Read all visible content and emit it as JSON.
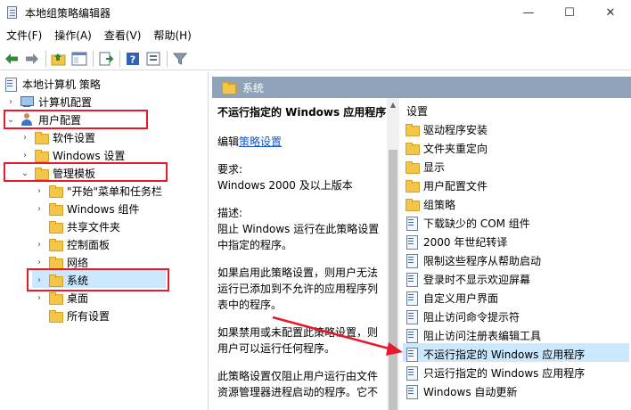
{
  "window": {
    "title": "本地组策略编辑器",
    "minimize": "—",
    "maximize": "☐",
    "close": "✕"
  },
  "menu": [
    "文件(F)",
    "操作(A)",
    "查看(V)",
    "帮助(H)"
  ],
  "tree": {
    "root": "本地计算机 策略",
    "computer_config": "计算机配置",
    "user_config": "用户配置",
    "software_settings": "软件设置",
    "windows_settings": "Windows 设置",
    "admin_templates": "管理模板",
    "start_menu": "\"开始\"菜单和任务栏",
    "windows_components": "Windows 组件",
    "shared_folders": "共享文件夹",
    "control_panel": "控制面板",
    "network": "网络",
    "system": "系统",
    "desktop": "桌面",
    "all_settings": "所有设置"
  },
  "header": {
    "title": "系统"
  },
  "description": {
    "title": "不运行指定的 Windows 应用程序",
    "edit_prefix": "编辑",
    "edit_link": "策略设置",
    "requirements_label": "要求:",
    "requirements_value": "Windows 2000 及以上版本",
    "desc_label": "描述:",
    "desc_text": "阻止 Windows 运行在此策略设置中指定的程序。",
    "enabled_text": "如果启用此策略设置，则用户无法运行已添加到不允许的应用程序列表中的程序。",
    "disabled_text": "如果禁用或未配置此策略设置，则用户可以运行任何程序。",
    "note_text": "此策略设置仅阻止用户运行由文件资源管理器进程启动的程序。它不"
  },
  "list": {
    "header": "设置",
    "items": [
      {
        "label": "驱动程序安装",
        "kind": "folder"
      },
      {
        "label": "文件夹重定向",
        "kind": "folder"
      },
      {
        "label": "显示",
        "kind": "folder"
      },
      {
        "label": "用户配置文件",
        "kind": "folder"
      },
      {
        "label": "组策略",
        "kind": "folder"
      },
      {
        "label": "下载缺少的 COM 组件",
        "kind": "policy"
      },
      {
        "label": "2000 年世纪转译",
        "kind": "policy"
      },
      {
        "label": "限制这些程序从帮助启动",
        "kind": "policy"
      },
      {
        "label": "登录时不显示欢迎屏幕",
        "kind": "policy"
      },
      {
        "label": "自定义用户界面",
        "kind": "policy"
      },
      {
        "label": "阻止访问命令提示符",
        "kind": "policy"
      },
      {
        "label": "阻止访问注册表编辑工具",
        "kind": "policy"
      },
      {
        "label": "不运行指定的 Windows 应用程序",
        "kind": "policy"
      },
      {
        "label": "只运行指定的 Windows 应用程序",
        "kind": "policy"
      },
      {
        "label": "Windows 自动更新",
        "kind": "policy"
      }
    ]
  },
  "colors": {
    "highlight_box": "#e8192c",
    "selection": "#cce8ff",
    "header_bar": "#8fa2b8",
    "link": "#1a56c2"
  }
}
